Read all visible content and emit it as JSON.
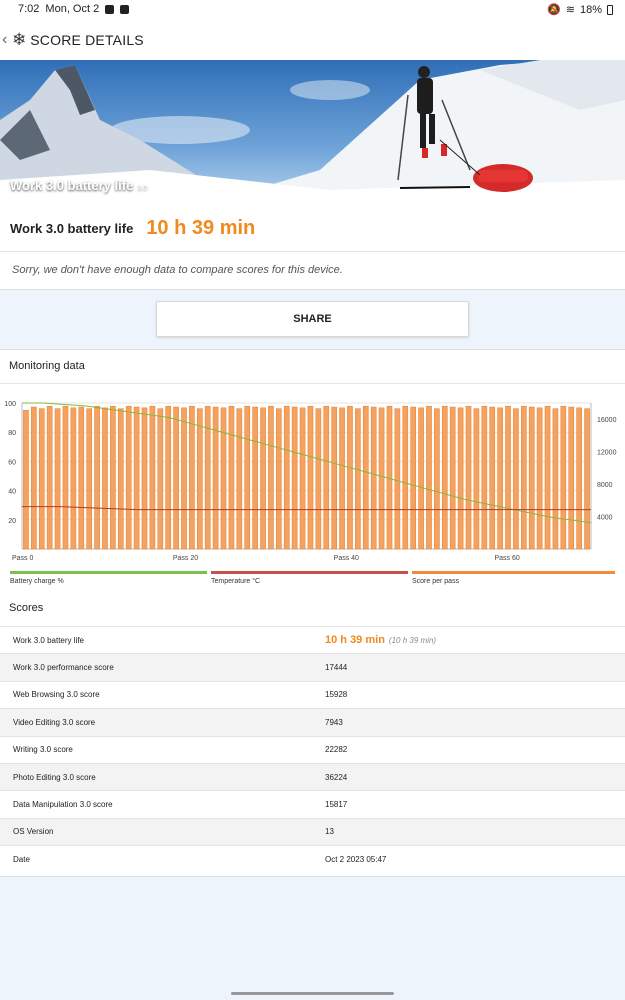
{
  "status_bar": {
    "time": "7:02",
    "date": "Mon, Oct 2",
    "battery": "18%"
  },
  "app_bar": {
    "back_icon": "chevron-left-icon",
    "logo_icon": "snowflake-icon",
    "title": "SCORE DETAILS"
  },
  "hero": {
    "caption": "Work 3.0 battery life",
    "version": "3.0"
  },
  "result": {
    "label": "Work 3.0 battery life",
    "value": "10 h 39 min",
    "note": "Sorry, we don't have enough data to compare scores for this device."
  },
  "share_label": "SHARE",
  "monitoring": {
    "title": "Monitoring data",
    "legend": [
      {
        "label": "Battery charge %",
        "color": "#7cc24a"
      },
      {
        "label": "Temperature °C",
        "color": "#c8504e"
      },
      {
        "label": "Score per pass",
        "color": "#f08a3c"
      }
    ]
  },
  "chart_data": {
    "type": "bar",
    "x_tick_labels": [
      "Pass 0",
      "Pass 20",
      "Pass 40",
      "Pass 60"
    ],
    "left_axis_ticks": [
      "20",
      "40",
      "60",
      "80",
      "100"
    ],
    "right_axis_ticks": [
      "4000",
      "8000",
      "12000",
      "16000"
    ],
    "left_ylim": [
      0,
      100
    ],
    "right_ylim": [
      0,
      18000
    ],
    "passes": 72,
    "score_per_pass": [
      17100,
      17500,
      17300,
      17600,
      17300,
      17600,
      17400,
      17500,
      17300,
      17600,
      17400,
      17600,
      17300,
      17600,
      17500,
      17400,
      17600,
      17300,
      17600,
      17500,
      17400,
      17600,
      17300,
      17600,
      17500,
      17400,
      17600,
      17300,
      17600,
      17500,
      17400,
      17600,
      17300,
      17600,
      17500,
      17400,
      17600,
      17300,
      17600,
      17500,
      17400,
      17600,
      17300,
      17600,
      17500,
      17400,
      17600,
      17300,
      17600,
      17500,
      17400,
      17600,
      17300,
      17600,
      17500,
      17400,
      17600,
      17300,
      17600,
      17500,
      17400,
      17600,
      17300,
      17600,
      17500,
      17400,
      17600,
      17300,
      17600,
      17500,
      17400,
      17300
    ],
    "battery_charge": [
      100,
      100,
      99,
      98,
      96,
      94,
      92,
      90,
      86,
      82,
      78,
      74,
      70,
      66,
      62,
      58,
      54,
      50,
      46,
      42,
      38,
      34,
      31,
      28,
      25,
      22,
      20,
      18
    ],
    "temperature": [
      29,
      29,
      28,
      27,
      27,
      27,
      27,
      27,
      27,
      27,
      27,
      27,
      27,
      27,
      27,
      27
    ],
    "grid": true
  },
  "scores": {
    "title": "Scores",
    "rows": [
      {
        "name": "Work 3.0 battery life",
        "value": "10 h 39 min",
        "sub": "(10 h 39 min)"
      },
      {
        "name": "Work 3.0 performance score",
        "value": "17444"
      },
      {
        "name": "Web Browsing 3.0 score",
        "value": "15928"
      },
      {
        "name": "Video Editing 3.0 score",
        "value": "7943"
      },
      {
        "name": "Writing 3.0 score",
        "value": "22282"
      },
      {
        "name": "Photo Editing 3.0 score",
        "value": "36224"
      },
      {
        "name": "Data Manipulation 3.0 score",
        "value": "15817"
      },
      {
        "name": "OS Version",
        "value": "13"
      },
      {
        "name": "Date",
        "value": "Oct 2 2023 05:47"
      }
    ]
  }
}
